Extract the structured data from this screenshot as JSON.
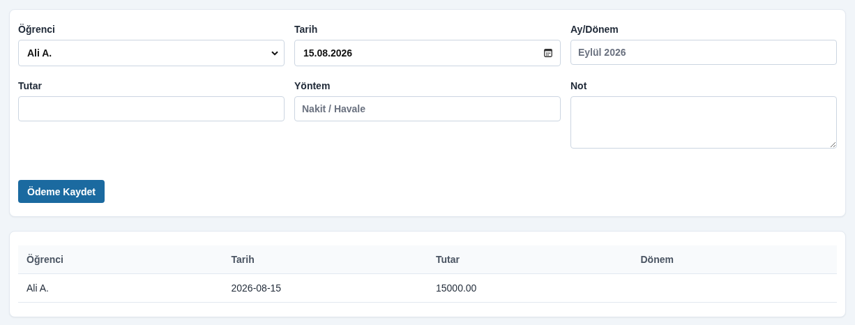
{
  "form": {
    "fields": [
      {
        "label": "Öğrenci",
        "kind": "select",
        "value": "Ali A."
      },
      {
        "label": "Tarih",
        "kind": "date",
        "value": "15.08.2026"
      },
      {
        "label": "Ay/Dönem",
        "kind": "text",
        "placeholder": "Eylül 2026"
      },
      {
        "label": "Tutar",
        "kind": "text"
      },
      {
        "label": "Yöntem",
        "kind": "text",
        "placeholder": "Nakit / Havale"
      },
      {
        "label": "Not",
        "kind": "textarea"
      }
    ],
    "submit": "Ödeme Kaydet"
  },
  "table": {
    "columns": [
      "Öğrenci",
      "Tarih",
      "Tutar",
      "Dönem"
    ],
    "rows": [
      {
        "cells": [
          "Ali A.",
          "2026-08-15",
          "15000.00"
        ]
      }
    ]
  }
}
